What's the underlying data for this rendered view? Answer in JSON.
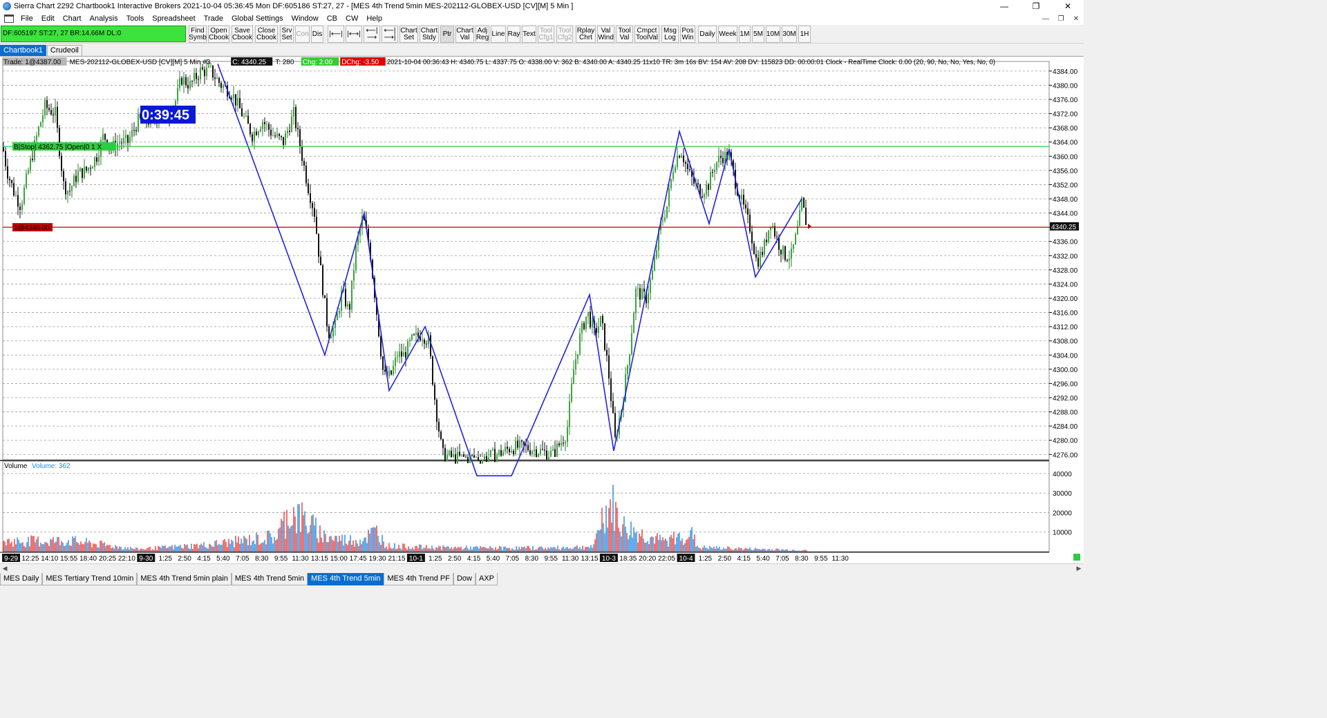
{
  "window": {
    "title": "Sierra Chart 2292 Chartbook1  Interactive Brokers 2021-10-04  05:36:45 Mon  DF:605186  ST:27, 27 - [MES 4th Trend 5min MES-202112-GLOBEX-USD [CV][M]  5 Min  ]",
    "minimize": "—",
    "maximize": "❐",
    "close": "✕"
  },
  "menu": [
    "File",
    "Edit",
    "Chart",
    "Analysis",
    "Tools",
    "Spreadsheet",
    "Trade",
    "Global Settings",
    "Window",
    "CB",
    "CW",
    "Help"
  ],
  "mdi_buttons": [
    "—",
    "❐",
    "✕"
  ],
  "toolbar": {
    "trade_info": "DF:605197  ST:27, 27  BR:14.66M  DL:0",
    "buttons": [
      {
        "label": "Find\nSymb"
      },
      {
        "label": "Open\nCbook"
      },
      {
        "label": "Save\nCbook"
      },
      {
        "label": "Close\nCbook"
      },
      {
        "label": "Srv\nSet"
      },
      {
        "label": "Con",
        "disabled": true
      },
      {
        "label": "Dis"
      },
      {
        "label": "|⟵|"
      },
      {
        "label": "|⟷|"
      },
      {
        "label": "⟵|⟶"
      },
      {
        "label": "⟵|⟶|"
      },
      {
        "label": "Chart\nSet"
      },
      {
        "label": "Chart\nStdy"
      },
      {
        "label": "Ptr",
        "pressed": true
      },
      {
        "label": "Chart\nVal"
      },
      {
        "label": "Adj\nReg"
      },
      {
        "label": "Line"
      },
      {
        "label": "Ray"
      },
      {
        "label": "Text"
      },
      {
        "label": "Tool\nCfg1",
        "disabled": true
      },
      {
        "label": "Tool\nCfg2",
        "disabled": true
      },
      {
        "label": "Rplay\nChrt"
      },
      {
        "label": "Val\nWind"
      },
      {
        "label": "Tool\nVal"
      },
      {
        "label": "Cmpct\nToolVal"
      },
      {
        "label": "Msg\nLog"
      },
      {
        "label": "Pos\nWin"
      },
      {
        "label": "Daily"
      },
      {
        "label": "Week"
      },
      {
        "label": "1M"
      },
      {
        "label": "5M"
      },
      {
        "label": "10M"
      },
      {
        "label": "30M"
      },
      {
        "label": "1H"
      }
    ]
  },
  "chartbook_tabs": [
    {
      "label": "Chartbook1",
      "active": true
    },
    {
      "label": "Crudeoil",
      "active": false
    }
  ],
  "chart_header": {
    "trade": "Trade: 1@4387.00",
    "symbol": "MES-202112-GLOBEX-USD [CV][M]  5 Min   #3",
    "close": "C: 4340.25",
    "trades": "T: 280",
    "chg": "Chg: 2.00",
    "dchg": "DChg: -3.50",
    "rest": "2021-10-04 00:36:43 H: 4340.75 L: 4337.75 O: 4338.00 V: 362 B: 4340.00 A: 4340.25 11x10 TR: 3m 16s BV: 154 AV: 208 DV: 115823 DD: 00:00:01 Clock - RealTime  Clock: 0.00   (20, 90, No, No, Yes, No, 0)"
  },
  "timer": "0:39:45",
  "stop_label": "B|Stop| 4362.75 |Open|0  1  X",
  "position_label": "1@4340.00",
  "volume_label": "Volume",
  "volume_value": "Volume: 362",
  "colors": {
    "up": "#2e7d32",
    "down": "#111111",
    "zigzag": "#2222dd",
    "stop": "#2ecc40",
    "position": "#b30000",
    "vol_up": "#1e88e5",
    "vol_down": "#e53935"
  },
  "chart_data": [
    {
      "type": "candlestick",
      "title": "MES 4th Trend 5min MES-202112-GLOBEX-USD [CV][M] 5 Min",
      "y_ticks": [
        4384,
        4380,
        4376,
        4372,
        4368,
        4364,
        4360,
        4356,
        4352,
        4348,
        4344,
        4340,
        4336,
        4332,
        4328,
        4324,
        4320,
        4316,
        4312,
        4308,
        4304,
        4300,
        4296,
        4292,
        4288,
        4284,
        4280,
        4276
      ],
      "y_tick_labels": [
        "4384.00",
        "4380.00",
        "4376.00",
        "4372.00",
        "4368.00",
        "4364.00",
        "4360.00",
        "4356.00",
        "4352.00",
        "4348.00",
        "4344.00",
        "4340.00",
        "4336.00",
        "4332.00",
        "4328.00",
        "4324.00",
        "4320.00",
        "4316.00",
        "4312.00",
        "4308.00",
        "4304.00",
        "4300.00",
        "4296.00",
        "4292.00",
        "4288.00",
        "4284.00",
        "4280.00",
        "4276.00"
      ],
      "ylim": [
        4274.5,
        4386.5
      ],
      "last_price": 4340.25,
      "last_price_label": "4340.25",
      "stop_price": 4362.75,
      "position_price": 4340.0,
      "x_labels": [
        "9-29",
        "12:25",
        "14:10",
        "15:55",
        "18:40",
        "20:25",
        "22:10",
        "9-30",
        "1:25",
        "2:50",
        "4:15",
        "5:40",
        "7:05",
        "8:30",
        "9:55",
        "11:30",
        "13:15",
        "15:00",
        "17:45",
        "19:30",
        "21:15",
        "10-1",
        "1:25",
        "2:50",
        "4:15",
        "5:40",
        "7:05",
        "8:30",
        "9:55",
        "11:30",
        "13:15",
        "10-3",
        "18:35",
        "20:20",
        "22:05",
        "10-4",
        "1:25",
        "2:50",
        "4:15",
        "5:40",
        "7:05",
        "8:30",
        "9:55",
        "11:30"
      ],
      "x_label_highlight": [
        "9-29",
        "9-30",
        "10-1",
        "10-3",
        "10-4"
      ],
      "path_anchors": [
        [
          0,
          4367
        ],
        [
          10,
          4356
        ],
        [
          20,
          4350
        ],
        [
          30,
          4346
        ],
        [
          40,
          4355
        ],
        [
          55,
          4367
        ],
        [
          65,
          4374
        ],
        [
          80,
          4372
        ],
        [
          92,
          4352
        ],
        [
          100,
          4350
        ],
        [
          112,
          4355
        ],
        [
          125,
          4356
        ],
        [
          140,
          4360
        ],
        [
          150,
          4366
        ],
        [
          160,
          4362
        ],
        [
          172,
          4364
        ],
        [
          185,
          4364
        ],
        [
          200,
          4370
        ],
        [
          215,
          4370
        ],
        [
          230,
          4371
        ],
        [
          245,
          4372
        ],
        [
          255,
          4376
        ],
        [
          262,
          4382
        ],
        [
          275,
          4380
        ],
        [
          290,
          4384
        ],
        [
          305,
          4384
        ],
        [
          320,
          4380
        ],
        [
          335,
          4378
        ],
        [
          350,
          4372
        ],
        [
          365,
          4366
        ],
        [
          380,
          4370
        ],
        [
          395,
          4366
        ],
        [
          410,
          4364
        ],
        [
          425,
          4372
        ],
        [
          435,
          4362
        ],
        [
          445,
          4352
        ],
        [
          455,
          4344
        ],
        [
          465,
          4326
        ],
        [
          475,
          4310
        ],
        [
          485,
          4312
        ],
        [
          495,
          4322
        ],
        [
          505,
          4316
        ],
        [
          515,
          4334
        ],
        [
          525,
          4343
        ],
        [
          535,
          4334
        ],
        [
          545,
          4316
        ],
        [
          555,
          4298
        ],
        [
          565,
          4298
        ],
        [
          575,
          4304
        ],
        [
          585,
          4304
        ],
        [
          595,
          4308
        ],
        [
          610,
          4310
        ],
        [
          620,
          4308
        ],
        [
          630,
          4290
        ],
        [
          640,
          4276
        ],
        [
          655,
          4275
        ],
        [
          675,
          4275
        ],
        [
          700,
          4275
        ],
        [
          720,
          4276
        ],
        [
          740,
          4278
        ],
        [
          760,
          4278
        ],
        [
          780,
          4277
        ],
        [
          800,
          4276
        ],
        [
          820,
          4282
        ],
        [
          830,
          4300
        ],
        [
          840,
          4310
        ],
        [
          850,
          4316
        ],
        [
          860,
          4310
        ],
        [
          870,
          4314
        ],
        [
          880,
          4300
        ],
        [
          890,
          4280
        ],
        [
          900,
          4290
        ],
        [
          910,
          4304
        ],
        [
          920,
          4322
        ],
        [
          935,
          4320
        ],
        [
          945,
          4328
        ],
        [
          955,
          4340
        ],
        [
          965,
          4346
        ],
        [
          975,
          4358
        ],
        [
          985,
          4362
        ],
        [
          995,
          4356
        ],
        [
          1005,
          4352
        ],
        [
          1015,
          4350
        ],
        [
          1025,
          4352
        ],
        [
          1035,
          4358
        ],
        [
          1045,
          4360
        ],
        [
          1055,
          4360
        ],
        [
          1065,
          4352
        ],
        [
          1075,
          4346
        ],
        [
          1085,
          4340
        ],
        [
          1095,
          4330
        ],
        [
          1105,
          4334
        ],
        [
          1115,
          4342
        ],
        [
          1125,
          4336
        ],
        [
          1135,
          4332
        ],
        [
          1145,
          4332
        ],
        [
          1155,
          4340
        ],
        [
          1160,
          4347
        ],
        [
          1168,
          4340
        ]
      ],
      "zigzag_points": [
        [
          315,
          4386
        ],
        [
          470,
          4304
        ],
        [
          527,
          4344
        ],
        [
          563,
          4294
        ],
        [
          615,
          4312
        ],
        [
          690,
          4270
        ],
        [
          740,
          4270
        ],
        [
          853,
          4321
        ],
        [
          888,
          4277
        ],
        [
          983,
          4367
        ],
        [
          1026,
          4341
        ],
        [
          1055,
          4362
        ],
        [
          1093,
          4326
        ],
        [
          1160,
          4348
        ]
      ]
    },
    {
      "type": "bar",
      "title": "Volume",
      "y_ticks": [
        40000,
        30000,
        20000,
        10000
      ],
      "y_tick_labels": [
        "40000",
        "30000",
        "20000",
        "10000"
      ],
      "ylim": [
        0,
        43500
      ],
      "last_value": 362,
      "volume_anchors": [
        [
          0,
          6000
        ],
        [
          100,
          6500
        ],
        [
          200,
          1500
        ],
        [
          300,
          4000
        ],
        [
          400,
          9000
        ],
        [
          420,
          24000
        ],
        [
          440,
          19000
        ],
        [
          470,
          9000
        ],
        [
          500,
          7000
        ],
        [
          520,
          7000
        ],
        [
          545,
          12000
        ],
        [
          560,
          3500
        ],
        [
          620,
          2500
        ],
        [
          700,
          2200
        ],
        [
          800,
          2200
        ],
        [
          860,
          3000
        ],
        [
          870,
          20000
        ],
        [
          885,
          28000
        ],
        [
          900,
          15000
        ],
        [
          930,
          10000
        ],
        [
          960,
          6000
        ],
        [
          1000,
          11000
        ],
        [
          1010,
          2500
        ],
        [
          1100,
          1500
        ],
        [
          1168,
          800
        ]
      ]
    }
  ],
  "bottom_tabs": [
    {
      "label": "MES Daily",
      "active": false
    },
    {
      "label": "MES Tertiary Trend 10min",
      "active": false
    },
    {
      "label": "MES 4th Trend 5min plain",
      "active": false
    },
    {
      "label": "MES 4th Trend 5min",
      "active": false
    },
    {
      "label": "MES 4th Trend 5min",
      "active": true
    },
    {
      "label": "MES 4th Trend PF",
      "active": false
    },
    {
      "label": "Dow",
      "active": false
    },
    {
      "label": "AXP",
      "active": false
    }
  ]
}
